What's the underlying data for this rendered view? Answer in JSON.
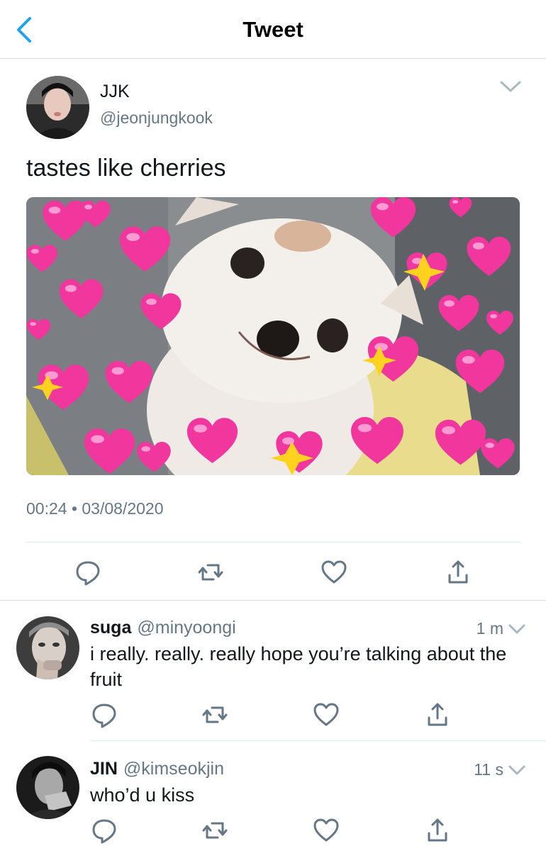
{
  "header": {
    "title": "Tweet",
    "back_icon": "chevron-left-icon",
    "accent": "#1da1f2"
  },
  "tweet": {
    "display_name": "JJK",
    "handle": "@jeonjungkook",
    "text": "tastes like cherries",
    "timestamp": "00:24 • 03/08/2020",
    "media": "photo of a small white chihuahua surrounded by pink heart emojis",
    "actions": [
      "reply-icon",
      "retweet-icon",
      "like-icon",
      "share-icon"
    ]
  },
  "replies": [
    {
      "display_name": "suga",
      "handle": "@minyoongi",
      "time": "1 m",
      "text": "i really. really. really hope you’re talking about the fruit"
    },
    {
      "display_name": "JIN",
      "handle": "@kimseokjin",
      "time": "11 s",
      "text": "who’d u kiss"
    }
  ],
  "colors": {
    "text": "#14171a",
    "secondary": "#657786",
    "divider": "#e1e8ed",
    "heart_pink": "#f1369e"
  }
}
